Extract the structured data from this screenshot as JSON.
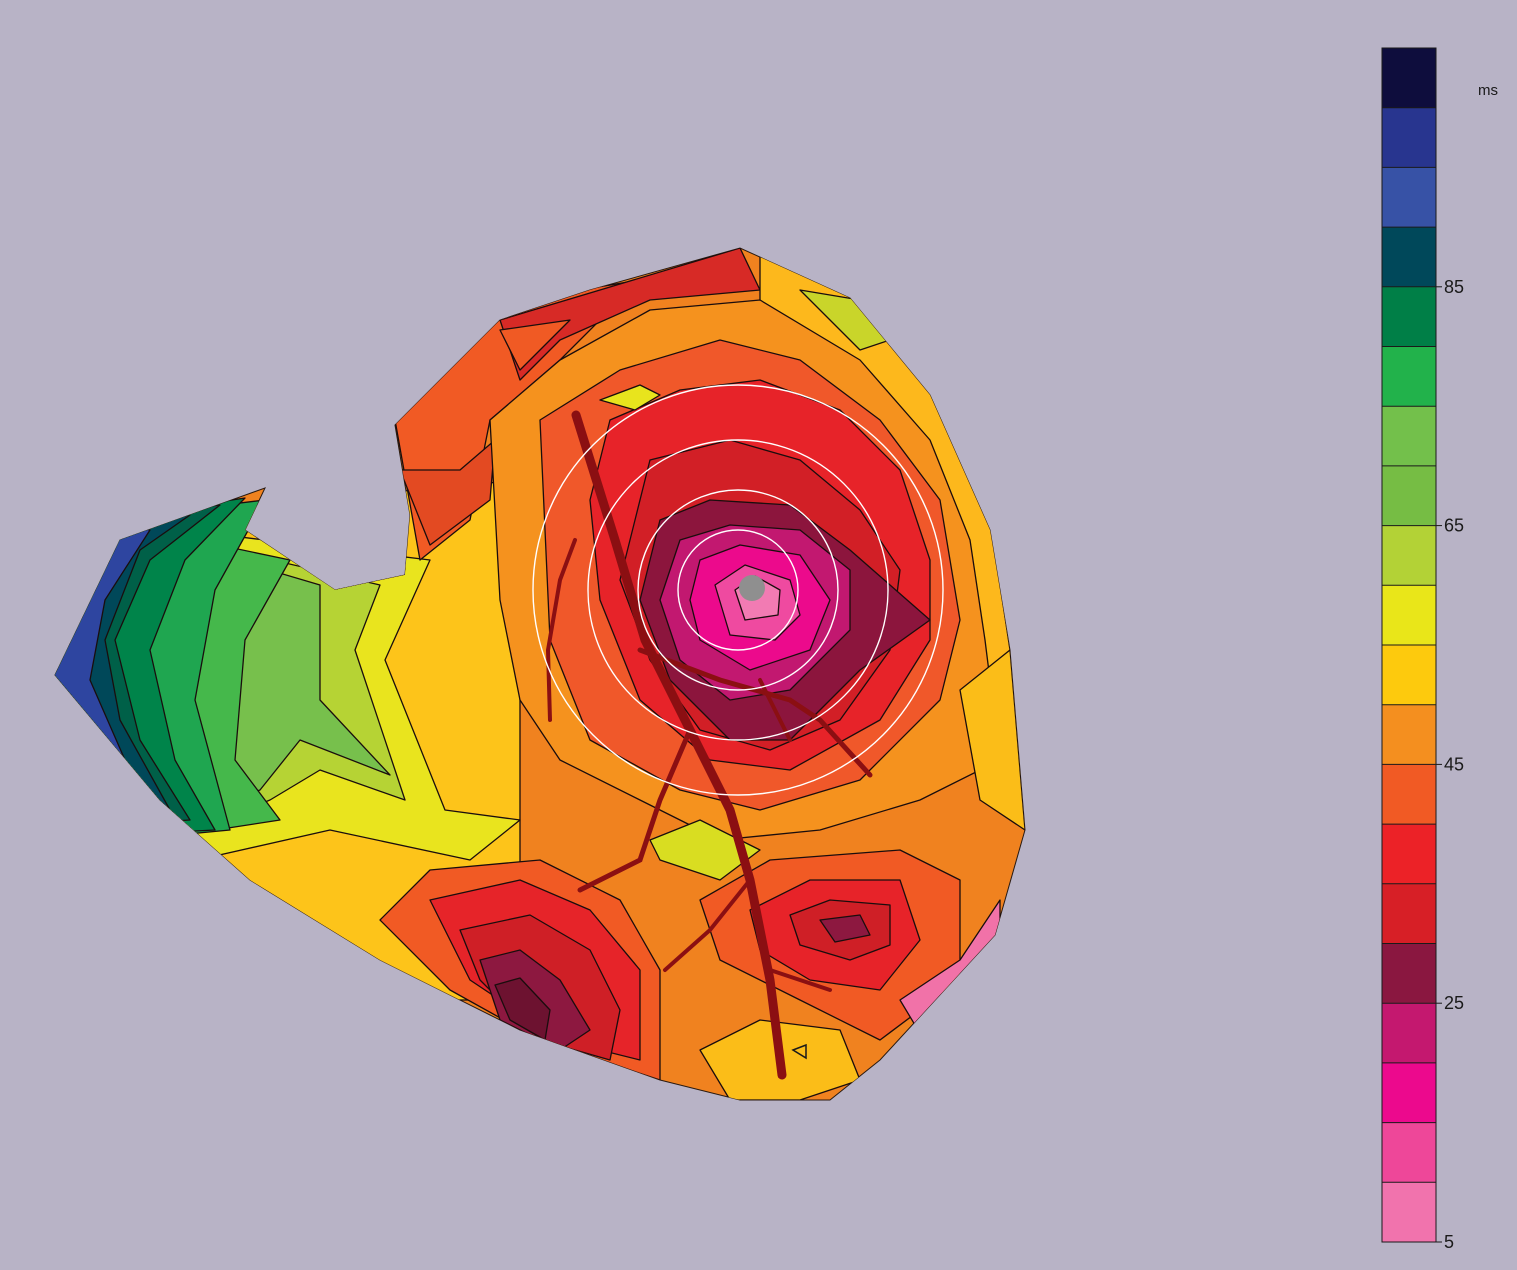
{
  "colorbar": {
    "unit": "ms",
    "ticks": [
      {
        "value": 85,
        "label": "85"
      },
      {
        "value": 65,
        "label": "65"
      },
      {
        "value": 45,
        "label": "45"
      },
      {
        "value": 25,
        "label": "25"
      },
      {
        "value": 5,
        "label": "5"
      }
    ],
    "bands_top_to_bottom": [
      "#0e0d3d",
      "#28358f",
      "#3752a6",
      "#00485a",
      "#007f47",
      "#22b24b",
      "#73c04b",
      "#76bd44",
      "#b3d236",
      "#e9e619",
      "#fdca0d",
      "#f48f1f",
      "#f15a24",
      "#ec2227",
      "#d71f26",
      "#8a1740",
      "#c4186f",
      "#ec098d",
      "#ee4799",
      "#f173ad"
    ]
  },
  "map": {
    "pacing_site_color": "#8f8f8f",
    "vessel_color": "#8b0f12",
    "ring_color": "#ffffff"
  }
}
